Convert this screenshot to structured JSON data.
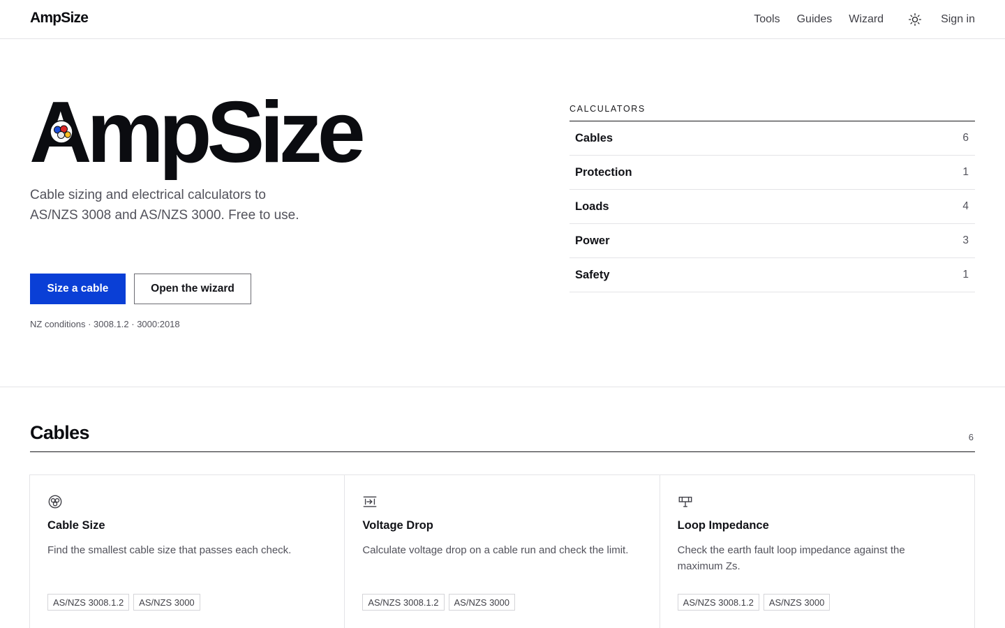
{
  "header": {
    "brand": "AmpSize",
    "nav": [
      "Tools",
      "Guides",
      "Wizard"
    ],
    "theme_icon": "sun-icon",
    "sign_in": "Sign in"
  },
  "hero": {
    "title": "AmpSize",
    "logo_icon": "cable-cores-icon",
    "subtitle": "Cable sizing and electrical calculators to AS/NZS 3008 and AS/NZS 3000. Free to use.",
    "primary_button": "Size a cable",
    "secondary_button": "Open the wizard",
    "standards_note": "NZ conditions · 3008.1.2 · 3000:2018"
  },
  "calculators": {
    "heading": "CALCULATORS",
    "items": [
      {
        "name": "Cables",
        "count": "6"
      },
      {
        "name": "Protection",
        "count": "1"
      },
      {
        "name": "Loads",
        "count": "4"
      },
      {
        "name": "Power",
        "count": "3"
      },
      {
        "name": "Safety",
        "count": "1"
      }
    ]
  },
  "cables_section": {
    "title": "Cables",
    "count": "6",
    "cards": [
      {
        "icon": "cable-cores-icon",
        "title": "Cable Size",
        "description": "Find the smallest cable size that passes each check.",
        "tags": [
          "AS/NZS 3008.1.2",
          "AS/NZS 3000"
        ]
      },
      {
        "icon": "voltage-drop-icon",
        "title": "Voltage Drop",
        "description": "Calculate voltage drop on a cable run and check the limit.",
        "tags": [
          "AS/NZS 3008.1.2",
          "AS/NZS 3000"
        ]
      },
      {
        "icon": "loop-impedance-icon",
        "title": "Loop Impedance",
        "description": "Check the earth fault loop impedance against the maximum Zs.",
        "tags": [
          "AS/NZS 3008.1.2",
          "AS/NZS 3000"
        ]
      }
    ]
  },
  "colors": {
    "accent": "#0a3fd6",
    "text": "#111217",
    "muted": "#52525b",
    "border": "#e4e4e7"
  }
}
